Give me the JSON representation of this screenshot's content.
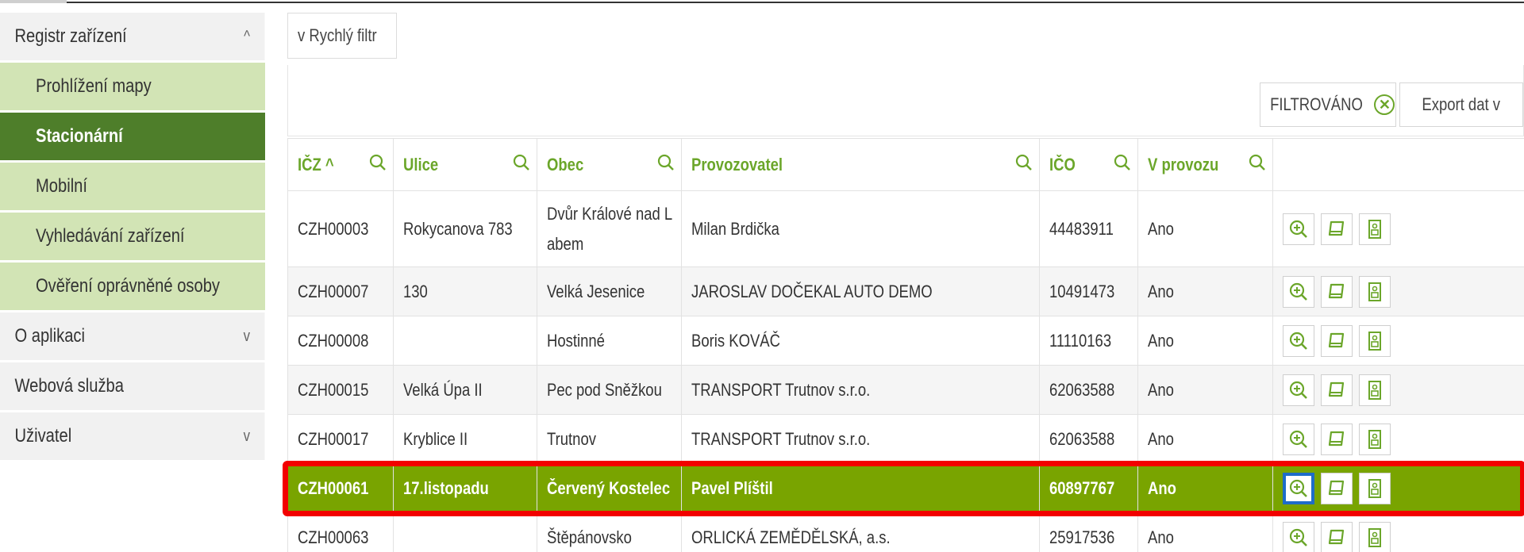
{
  "sidebar": {
    "items": [
      {
        "label": "Registr zařízení",
        "caret": "^"
      },
      {
        "label": "O aplikaci",
        "caret": "v"
      },
      {
        "label": "Webová služba",
        "caret": ""
      },
      {
        "label": "Uživatel",
        "caret": "v"
      }
    ],
    "subitems": [
      {
        "label": "Prohlížení mapy"
      },
      {
        "label": "Stacionární"
      },
      {
        "label": "Mobilní"
      },
      {
        "label": "Vyhledávání zařízení"
      },
      {
        "label": "Ověření oprávněné osoby"
      }
    ]
  },
  "filter": {
    "quick_label": "Rychlý filtr",
    "quick_caret": "v"
  },
  "toolbar": {
    "filtered_label": "FILTROVÁNO",
    "export_label": "Export dat",
    "export_caret": "v"
  },
  "table": {
    "columns": [
      {
        "label": "IČZ ^"
      },
      {
        "label": "Ulice"
      },
      {
        "label": "Obec"
      },
      {
        "label": "Provozovatel"
      },
      {
        "label": "IČO"
      },
      {
        "label": "V provozu"
      }
    ],
    "rows": [
      {
        "icz": "CZH00003",
        "ulice": "Rokycanova 783",
        "obec": "Dvůr Králové nad Labem",
        "provozovatel": "Milan Brdička",
        "ico": "44483911",
        "provoz": "Ano"
      },
      {
        "icz": "CZH00007",
        "ulice": "130",
        "obec": "Velká Jesenice",
        "provozovatel": "JAROSLAV DOČEKAL AUTO DEMO",
        "ico": "10491473",
        "provoz": "Ano"
      },
      {
        "icz": "CZH00008",
        "ulice": "",
        "obec": "Hostinné",
        "provozovatel": "Boris KOVÁČ",
        "ico": "11110163",
        "provoz": "Ano"
      },
      {
        "icz": "CZH00015",
        "ulice": "Velká Úpa II",
        "obec": "Pec pod Sněžkou",
        "provozovatel": "TRANSPORT Trutnov s.r.o.",
        "ico": "62063588",
        "provoz": "Ano"
      },
      {
        "icz": "CZH00017",
        "ulice": "Kryblice II",
        "obec": "Trutnov",
        "provozovatel": "TRANSPORT Trutnov s.r.o.",
        "ico": "62063588",
        "provoz": "Ano"
      },
      {
        "icz": "CZH00061",
        "ulice": "17.listopadu",
        "obec": "Červený Kostelec",
        "provozovatel": "Pavel Plíštil",
        "ico": "60897767",
        "provoz": "Ano"
      },
      {
        "icz": "CZH00063",
        "ulice": "",
        "obec": "Štěpánovsko",
        "provozovatel": "ORLICKÁ ZEMĚDĚLSKÁ, a.s.",
        "ico": "25917536",
        "provoz": "Ano"
      }
    ]
  },
  "colors": {
    "accent": "#6ba62a",
    "active_nav": "#4e7e2a",
    "selected_row": "#79a400",
    "highlight_red": "#f20000",
    "focus_blue": "#1e6cc8"
  },
  "icons": [
    "zoom-in-icon",
    "edit-icon",
    "document-icon",
    "search-icon",
    "clear-filter-icon"
  ]
}
